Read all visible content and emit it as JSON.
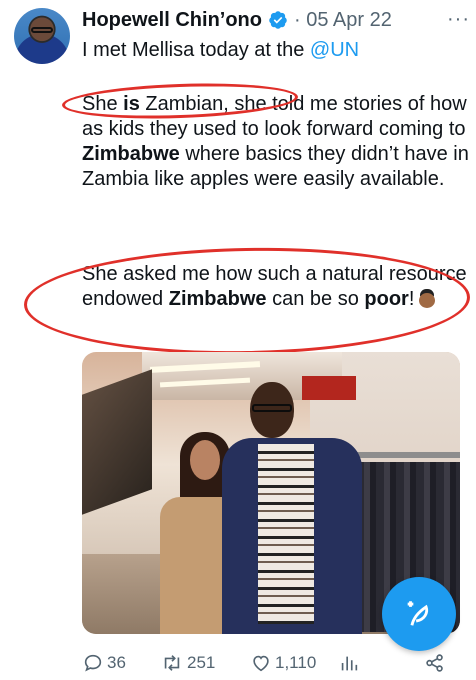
{
  "tweet": {
    "author_name": "Hopewell Chin’ono",
    "separator": "·",
    "date": "05 Apr 22",
    "more": "···",
    "line1_prefix": "I met Mellisa today at the ",
    "mention": "@UN",
    "p2": {
      "seg1": "She ",
      "seg2_bold": "is",
      "seg3": " Zambian, she told me stories of how as kids they used to look forward coming to ",
      "seg4_bold": "Zimbabwe",
      "seg5": " where basics they didn’t have in Zambia like apples were easily available."
    },
    "p3": {
      "seg1": "She asked me how such a natural resource endowed ",
      "seg2_bold": "Zimbabwe",
      "seg3": " can be so ",
      "seg4_bold": "poor",
      "seg5": "!"
    }
  },
  "actions": {
    "replies": "36",
    "retweets": "251",
    "likes": "1,110"
  },
  "colors": {
    "accent": "#1d9bf0",
    "annotation_red": "#e0302a",
    "secondary_text": "#536471"
  },
  "icons": {
    "verified": "verified-badge-icon",
    "reply": "reply-icon",
    "retweet": "retweet-icon",
    "like": "heart-icon",
    "views": "views-bar-chart-icon",
    "share": "share-icon",
    "compose": "compose-tweet-icon",
    "emoji": "man-facepalming-emoji"
  }
}
